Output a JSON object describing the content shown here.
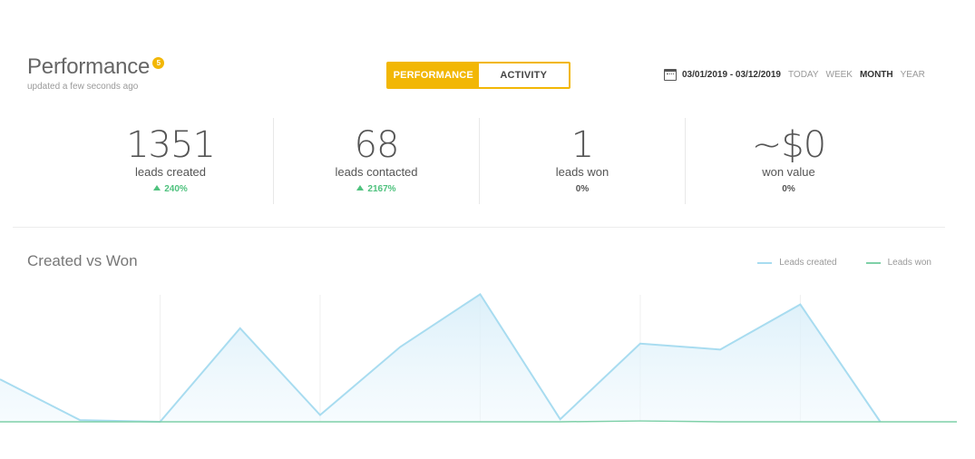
{
  "header": {
    "title": "Performance",
    "badge": "5",
    "subtitle": "updated a few seconds ago"
  },
  "toggle": {
    "tabs": [
      {
        "label": "PERFORMANCE",
        "active": true
      },
      {
        "label": "ACTIVITY",
        "active": false
      }
    ]
  },
  "date_filter": {
    "range": "03/01/2019 - 03/12/2019",
    "periods": [
      "TODAY",
      "WEEK",
      "MONTH",
      "YEAR"
    ],
    "selected": "MONTH"
  },
  "stats": [
    {
      "value": "1351",
      "label": "leads created",
      "change": "240%",
      "trend": "up"
    },
    {
      "value": "68",
      "label": "leads contacted",
      "change": "2167%",
      "trend": "up"
    },
    {
      "value": "1",
      "label": "leads won",
      "change": "0%",
      "trend": "none"
    },
    {
      "value": "~$0",
      "label": "won value",
      "change": "0%",
      "trend": "none"
    }
  ],
  "chart_title": "Created vs Won",
  "colors": {
    "accent": "#f2b705",
    "leads_created": "#a8dcf0",
    "leads_won": "#7fd0a8",
    "up": "#4fc27e"
  },
  "chart_data": {
    "type": "area",
    "title": "Created vs Won",
    "x": [
      0,
      1,
      2,
      3,
      4,
      5,
      6,
      7,
      8,
      9,
      10,
      11
    ],
    "series": [
      {
        "name": "Leads created",
        "values": [
          50,
          2,
          0,
          110,
          8,
          88,
          150,
          3,
          92,
          85,
          138,
          0
        ]
      },
      {
        "name": "Leads won",
        "values": [
          0,
          0,
          0,
          0,
          0,
          0,
          0,
          0,
          1,
          0,
          0,
          0
        ]
      }
    ],
    "ylim": [
      0,
      160
    ],
    "grid": true,
    "legend": "top-right"
  }
}
